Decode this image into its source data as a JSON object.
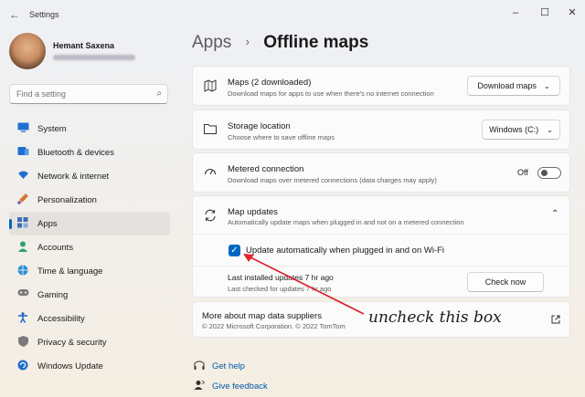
{
  "window": {
    "title": "Settings",
    "controls": [
      "–",
      "☐",
      "✕"
    ]
  },
  "profile": {
    "name": "Hemant Saxena"
  },
  "search": {
    "placeholder": "Find a setting"
  },
  "sidebar": {
    "items": [
      {
        "label": "System",
        "icon": "monitor-icon",
        "color": "#1f6fcf",
        "active": false
      },
      {
        "label": "Bluetooth & devices",
        "icon": "bluetooth-icon",
        "color": "#1f6fcf",
        "active": false
      },
      {
        "label": "Network & internet",
        "icon": "wifi-icon",
        "color": "#1f6fcf",
        "active": false
      },
      {
        "label": "Personalization",
        "icon": "brush-icon",
        "color": "#d67a35",
        "active": false
      },
      {
        "label": "Apps",
        "icon": "apps-icon",
        "color": "#3d6fb6",
        "active": true
      },
      {
        "label": "Accounts",
        "icon": "person-icon",
        "color": "#2ea36b",
        "active": false
      },
      {
        "label": "Time & language",
        "icon": "globe-icon",
        "color": "#2d8fd4",
        "active": false
      },
      {
        "label": "Gaming",
        "icon": "gamepad-icon",
        "color": "#7a7a7a",
        "active": false
      },
      {
        "label": "Accessibility",
        "icon": "accessibility-icon",
        "color": "#1a64c8",
        "active": false
      },
      {
        "label": "Privacy & security",
        "icon": "shield-icon",
        "color": "#7a7a7a",
        "active": false
      },
      {
        "label": "Windows Update",
        "icon": "update-icon",
        "color": "#1f6fcf",
        "active": false
      }
    ]
  },
  "breadcrumb": {
    "parent": "Apps",
    "separator": "›",
    "current": "Offline maps"
  },
  "maps": {
    "title": "Maps (2 downloaded)",
    "desc": "Download maps for apps to use when there's no internet connection",
    "button": "Download maps"
  },
  "storage": {
    "title": "Storage location",
    "desc": "Choose where to save offline maps",
    "value": "Windows (C:)"
  },
  "metered": {
    "title": "Metered connection",
    "desc": "Download maps over metered connections (data charges may apply)",
    "state": "Off"
  },
  "updates": {
    "title": "Map updates",
    "desc": "Automatically update maps when plugged in and not on a metered connection",
    "checkbox_label": "Update automatically when plugged in and on Wi-Fi",
    "last_installed": "Last installed updates 7 hr ago",
    "last_checked": "Last checked for updates 7 hr ago",
    "button": "Check now"
  },
  "suppliers": {
    "title": "More about map data suppliers",
    "desc": "© 2022 Microsoft Corporation. © 2022 TomTom"
  },
  "footer_links": {
    "help": "Get help",
    "feedback": "Give feedback"
  },
  "annotation": {
    "text": "uncheck this box",
    "color": "#e0262d"
  }
}
